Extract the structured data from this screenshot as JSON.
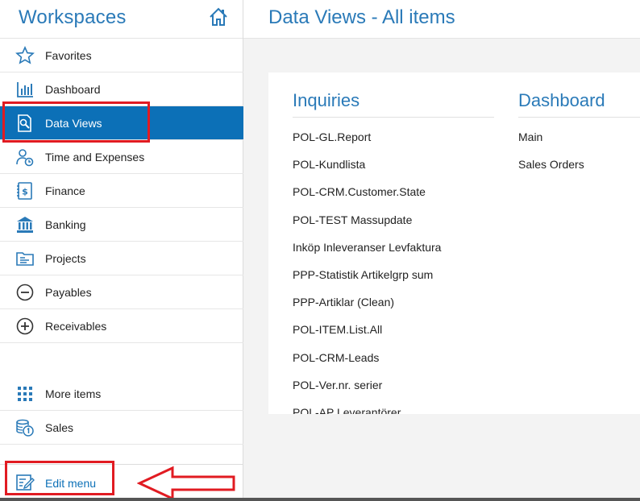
{
  "sidebar": {
    "title": "Workspaces",
    "home_icon": "home-icon",
    "items": [
      {
        "label": "Favorites",
        "icon": "star-icon"
      },
      {
        "label": "Dashboard",
        "icon": "bar-chart-icon"
      },
      {
        "label": "Data Views",
        "icon": "data-views-icon",
        "active": true
      },
      {
        "label": "Time and Expenses",
        "icon": "time-expenses-icon"
      },
      {
        "label": "Finance",
        "icon": "finance-icon"
      },
      {
        "label": "Banking",
        "icon": "bank-icon"
      },
      {
        "label": "Projects",
        "icon": "projects-icon"
      },
      {
        "label": "Payables",
        "icon": "minus-circle-icon"
      },
      {
        "label": "Receivables",
        "icon": "plus-circle-icon"
      }
    ],
    "more_items": [
      {
        "label": "More items",
        "icon": "grid-icon"
      },
      {
        "label": "Sales",
        "icon": "coins-icon"
      }
    ],
    "edit_menu": {
      "label": "Edit menu",
      "icon": "edit-menu-icon"
    }
  },
  "main": {
    "title": "Data Views - All items",
    "columns": [
      {
        "title": "Inquiries",
        "items": [
          "POL-GL.Report",
          "POL-Kundlista",
          "POL-CRM.Customer.State",
          "POL-TEST Massupdate",
          "Inköp Inleveranser Levfaktura",
          "PPP-Statistik Artikelgrp sum",
          "PPP-Artiklar (Clean)",
          "POL-ITEM.List.All",
          "POL-CRM-Leads",
          "POL-Ver.nr. serier",
          "POL-AP Leverantörer"
        ]
      },
      {
        "title": "Dashboard",
        "items": [
          "Main",
          "Sales Orders"
        ]
      }
    ]
  },
  "colors": {
    "accent": "#2a7ab8",
    "active_bg": "#0c70b7",
    "annotation": "#e11b22"
  }
}
